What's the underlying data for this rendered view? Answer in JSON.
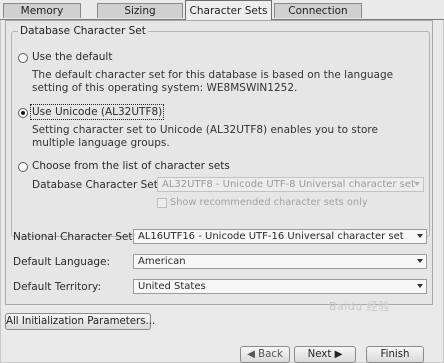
{
  "tabs": [
    "Memory",
    "Sizing",
    "Character Sets",
    "Connection Mode"
  ],
  "active_tab": "Character Sets",
  "db_charset_group": {
    "title": "Database Character Set",
    "options": [
      {
        "label": "Use the default",
        "selected": false,
        "description": "The default character set for this database is based on the language setting of this operating system: WE8MSWIN1252."
      },
      {
        "label": "Use Unicode (AL32UTF8)",
        "selected": true,
        "description": "Setting character set to Unicode (AL32UTF8) enables you to store multiple language groups."
      },
      {
        "label": "Choose from the list of character sets",
        "selected": false
      }
    ],
    "charset_field_label": "Database Character Set:",
    "charset_value": "AL32UTF8 - Unicode UTF-8 Universal character set",
    "show_recommended_label": "Show recommended character sets only",
    "show_recommended_checked": false
  },
  "fields": [
    {
      "label": "National Character Set:",
      "value": "AL16UTF16 - Unicode UTF-16 Universal character set"
    },
    {
      "label": "Default Language:",
      "value": "American"
    },
    {
      "label": "Default Territory:",
      "value": "United States"
    }
  ],
  "buttons": {
    "init_params": "All Initialization Parameters...",
    "back": "Back",
    "next": "Next",
    "finish": "Finish"
  },
  "watermark": "Baidu 经验"
}
